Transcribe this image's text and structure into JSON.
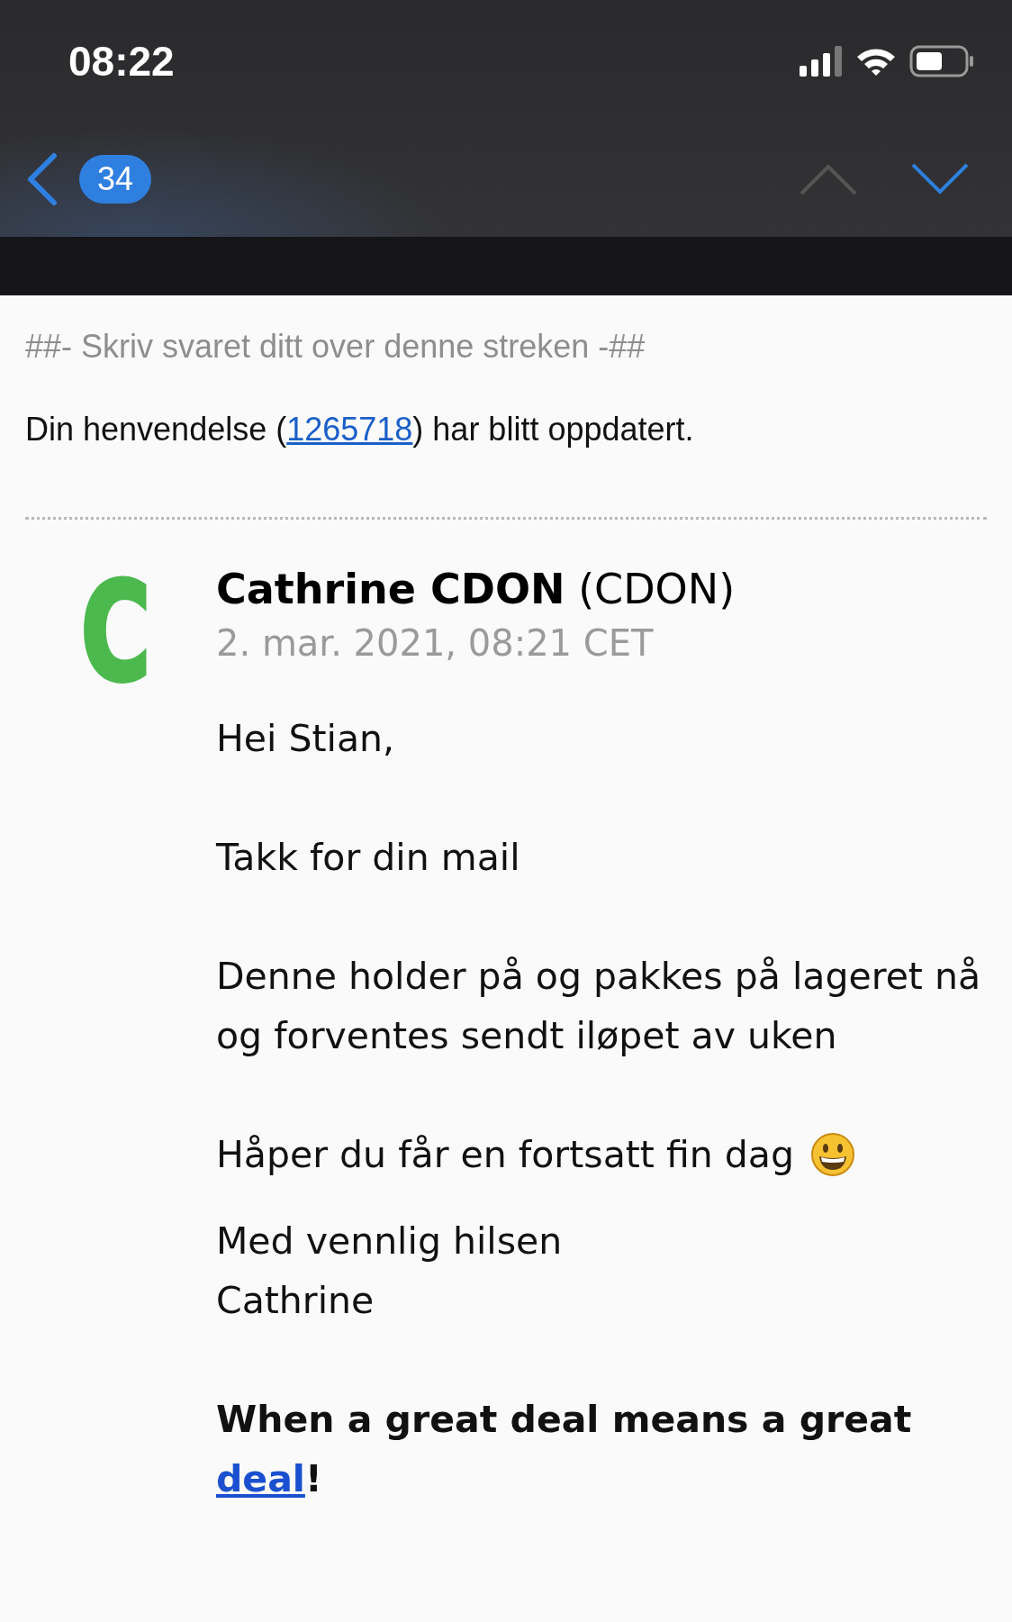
{
  "status_bar": {
    "time": "08:22"
  },
  "nav": {
    "unread_count": "34",
    "prev_enabled": false,
    "next_enabled": true
  },
  "email": {
    "reply_marker": "##- Skriv svaret ditt over denne streken -##",
    "update_notice": {
      "before": "Din henvendelse (",
      "link": "1265718",
      "after": ") har blitt oppdatert."
    },
    "message": {
      "avatar_letter": "C",
      "sender_name": "Cathrine CDON",
      "sender_org": "(CDON)",
      "date": "2. mar. 2021, 08:21 CET",
      "paragraphs": [
        {
          "kind": "text",
          "text": "Hei Stian,"
        },
        {
          "kind": "text",
          "text": "Takk for din mail"
        },
        {
          "kind": "text",
          "text": "Denne holder på og pakkes på lageret nå og forventes sendt iløpet av uken"
        },
        {
          "kind": "emoji",
          "text": "Håper du får en fortsatt fin dag"
        },
        {
          "kind": "lines",
          "lines": [
            "Med vennlig hilsen",
            "Cathrine"
          ]
        },
        {
          "kind": "slogan",
          "before": "When a great deal means a great ",
          "link": "deal",
          "after": "!"
        }
      ]
    }
  }
}
